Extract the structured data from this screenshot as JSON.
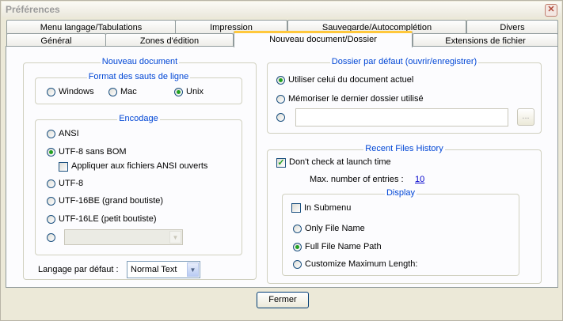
{
  "window": {
    "title": "Préférences",
    "close_glyph": "✕"
  },
  "tabs_row1": [
    "Menu langage/Tabulations",
    "Impression",
    "Sauvegarde/Autocomplétion",
    "Divers"
  ],
  "tabs_row2": [
    "Général",
    "Zones d'édition",
    "Nouveau document/Dossier",
    "Extensions de fichier"
  ],
  "active_tab": "Nouveau document/Dossier",
  "new_doc": {
    "title": "Nouveau document",
    "line_endings": {
      "title": "Format des sauts de ligne",
      "options": [
        "Windows",
        "Mac",
        "Unix"
      ],
      "selected": "Unix"
    },
    "encoding": {
      "title": "Encodage",
      "options": [
        "ANSI",
        "UTF-8 sans BOM",
        "UTF-8",
        "UTF-16BE (grand boutiste)",
        "UTF-16LE (petit boutiste)"
      ],
      "selected": "UTF-8 sans BOM",
      "apply_ansi_label": "Appliquer aux fichiers ANSI ouverts",
      "apply_ansi_checked": false,
      "other_combo_value": ""
    },
    "default_lang_label": "Langage par défaut :",
    "default_lang_value": "Normal Text"
  },
  "default_dir": {
    "title": "Dossier par défaut (ouvrir/enregistrer)",
    "options": [
      "Utiliser celui du document actuel",
      "Mémoriser le dernier dossier utilisé"
    ],
    "selected": "Utiliser celui du document actuel",
    "path_value": "",
    "browse_label": "..."
  },
  "recent": {
    "title": "Recent Files History",
    "dont_check_label": "Don't check at launch time",
    "dont_check_checked": true,
    "max_label": "Max. number of entries :",
    "max_value": "10",
    "display": {
      "title": "Display",
      "in_submenu_label": "In Submenu",
      "in_submenu_checked": false,
      "options": [
        "Only File Name",
        "Full File Name Path",
        "Customize Maximum Length:"
      ],
      "selected": "Full File Name Path"
    }
  },
  "close_button": "Fermer",
  "colors": {
    "accent_tab": "#ffc83c",
    "group_title": "#0046d5",
    "radio_dot": "#21a121"
  }
}
